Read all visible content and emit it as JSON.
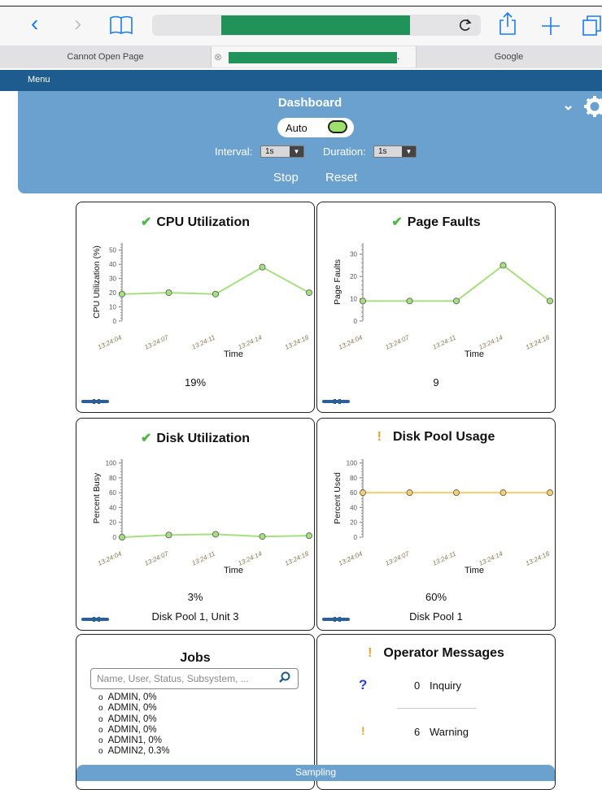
{
  "browser": {
    "tabs": [
      {
        "label": "Cannot Open Page"
      },
      {
        "label": "."
      },
      {
        "label": "Google"
      }
    ]
  },
  "menu": {
    "label": "Menu"
  },
  "header": {
    "title": "Dashboard",
    "auto_label": "Auto",
    "interval_label": "Interval:",
    "interval_value": "1s",
    "duration_label": "Duration:",
    "duration_value": "1s",
    "stop_label": "Stop",
    "reset_label": "Reset"
  },
  "colors": {
    "header_bg": "#6aa1cf",
    "menubar_bg": "#1e5b8f",
    "ok_green": "#4cb848",
    "warn_orange": "#f0a020",
    "line_green": "#a6e07e",
    "line_yellow": "#f7cf6a"
  },
  "cards": {
    "cpu": {
      "title": "CPU Utilization",
      "value": "19%",
      "status": "check-icon"
    },
    "faults": {
      "title": "Page Faults",
      "value": "9",
      "status": "check-icon"
    },
    "disk": {
      "title": "Disk Utilization",
      "value": "3%",
      "sub": "Disk Pool 1, Unit 3",
      "status": "check-icon"
    },
    "pool": {
      "title": "Disk Pool Usage",
      "value": "60%",
      "sub": "Disk Pool 1",
      "status": "exclamation-icon"
    }
  },
  "chart_data": [
    {
      "id": "cpu",
      "type": "line",
      "xlabel": "Time",
      "ylabel": "CPU Utilization (%)",
      "x": [
        "13:24:04",
        "13:24:07",
        "13:24:11",
        "13:24:14",
        "13:24:18"
      ],
      "values": [
        19,
        20,
        19,
        38,
        20
      ],
      "ylim": [
        0,
        55
      ],
      "yticks": [
        0,
        10,
        20,
        30,
        40,
        50
      ],
      "color": "#a6e07e"
    },
    {
      "id": "faults",
      "type": "line",
      "xlabel": "Time",
      "ylabel": "Page Faults",
      "x": [
        "13:24:04",
        "13:24:07",
        "13:24:11",
        "13:24:14",
        "13:24:18"
      ],
      "values": [
        9,
        9,
        9,
        25,
        9
      ],
      "ylim": [
        0,
        35
      ],
      "yticks": [
        0,
        10,
        20,
        30
      ],
      "color": "#a6e07e"
    },
    {
      "id": "disk",
      "type": "line",
      "xlabel": "Time",
      "ylabel": "Percent Busy",
      "x": [
        "13:24:04",
        "13:24:07",
        "13:24:11",
        "13:24:14",
        "13:24:18"
      ],
      "values": [
        0,
        3,
        4,
        1,
        2
      ],
      "ylim": [
        0,
        105
      ],
      "yticks": [
        0,
        20,
        40,
        60,
        80,
        100
      ],
      "color": "#a6e07e"
    },
    {
      "id": "pool",
      "type": "line",
      "xlabel": "Time",
      "ylabel": "Percent Used",
      "x": [
        "13:24:04",
        "13:24:07",
        "13:24:11",
        "13:24:14",
        "13:24:18"
      ],
      "values": [
        60,
        60,
        60,
        60,
        60
      ],
      "ylim": [
        0,
        105
      ],
      "yticks": [
        0,
        20,
        40,
        60,
        80,
        100
      ],
      "color": "#f7cf6a"
    }
  ],
  "jobs": {
    "title": "Jobs",
    "search_placeholder": "Name, User, Status, Subsystem, ...",
    "items": [
      "ADMIN, 0%",
      "ADMIN, 0%",
      "ADMIN, 0%",
      "ADMIN, 0%",
      "ADMIN1, 0%",
      "ADMIN2, 0.3%"
    ]
  },
  "operator": {
    "title": "Operator Messages",
    "inquiry_count": "0",
    "inquiry_label": "Inquiry",
    "warning_count": "6",
    "warning_label": "Warning"
  },
  "footer": {
    "label": "Sampling"
  }
}
